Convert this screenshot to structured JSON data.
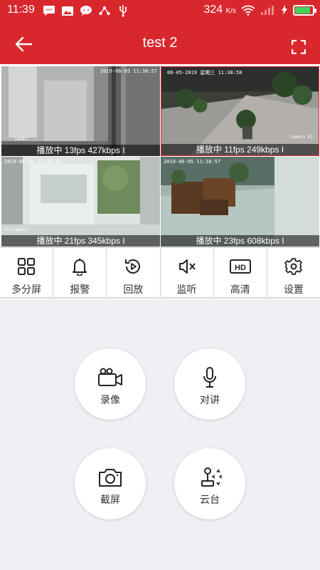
{
  "status_bar": {
    "time": "11:39",
    "network_speed": "324",
    "network_unit": "K/s",
    "battery_level": 0.9,
    "icons": [
      "message-bubble-icon",
      "image-icon",
      "chat-icon",
      "share-icon",
      "usb-icon",
      "wifi-icon",
      "signal-icon",
      "charging-icon",
      "battery-icon"
    ]
  },
  "header": {
    "title": "test 2",
    "back_icon": "arrow-left-icon",
    "fullscreen_icon": "fullscreen-icon"
  },
  "cameras": [
    {
      "osd_time": "2019-06-05 11:38:57",
      "osd_name": "CAM01",
      "stats": "播放中 13fps 427kbps I"
    },
    {
      "osd_time": "06-05-2019 星期三 11:38:58",
      "osd_name": "Camera 01",
      "stats": "播放中 11fps 249kbps I"
    },
    {
      "osd_time": "2019-06-05 11:38:58",
      "osd_name": "IP Camera",
      "stats": "播放中 21fps 345kbps I"
    },
    {
      "osd_time": "2019-06-05 11:38:57",
      "osd_name": "",
      "stats": "播放中 23fps 608kbps I"
    }
  ],
  "toolbar": [
    {
      "label": "多分屏",
      "icon": "grid-icon"
    },
    {
      "label": "报警",
      "icon": "bell-icon"
    },
    {
      "label": "回放",
      "icon": "replay-icon"
    },
    {
      "label": "监听",
      "icon": "speaker-mute-icon"
    },
    {
      "label": "高清",
      "icon": "hd-icon"
    },
    {
      "label": "设置",
      "icon": "gear-icon"
    }
  ],
  "actions": {
    "record": {
      "label": "录像",
      "icon": "video-camera-icon"
    },
    "talk": {
      "label": "对讲",
      "icon": "microphone-icon"
    },
    "snapshot": {
      "label": "截屏",
      "icon": "camera-icon"
    },
    "ptz": {
      "label": "云台",
      "icon": "joystick-icon"
    }
  },
  "colors": {
    "brand_red": "#d9272e",
    "background": "#efeff4",
    "battery_green": "#3ed65a"
  }
}
